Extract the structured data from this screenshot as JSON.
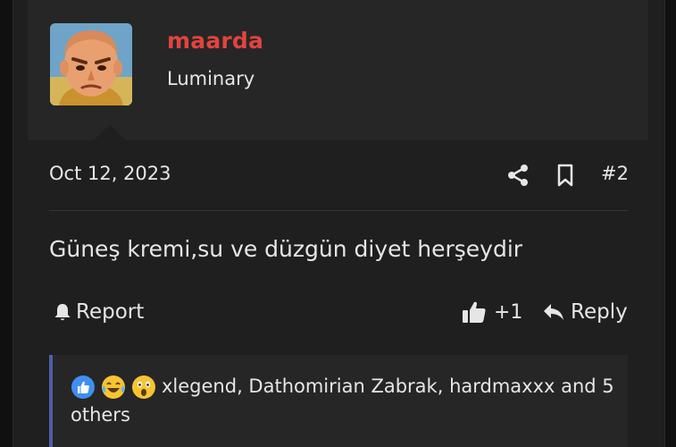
{
  "user": {
    "name": "maarda",
    "title": "Luminary",
    "name_color": "#e2433f"
  },
  "post": {
    "date": "Oct 12, 2023",
    "number": "#2",
    "body": "Güneş kremi,su ve düzgün diyet herşeydir"
  },
  "actions": {
    "report_label": "Report",
    "like_count": "+1",
    "reply_label": "Reply"
  },
  "reactions": {
    "icons": [
      "like-reaction-icon",
      "laugh-cry-reaction-icon",
      "wow-reaction-icon"
    ],
    "text": "xlegend, Dathomirian Zabrak, hardmaxxx and 5 others"
  },
  "colors": {
    "background": "#1f1f1f",
    "userbar": "#262626",
    "accent_border": "#4d5fa8"
  }
}
